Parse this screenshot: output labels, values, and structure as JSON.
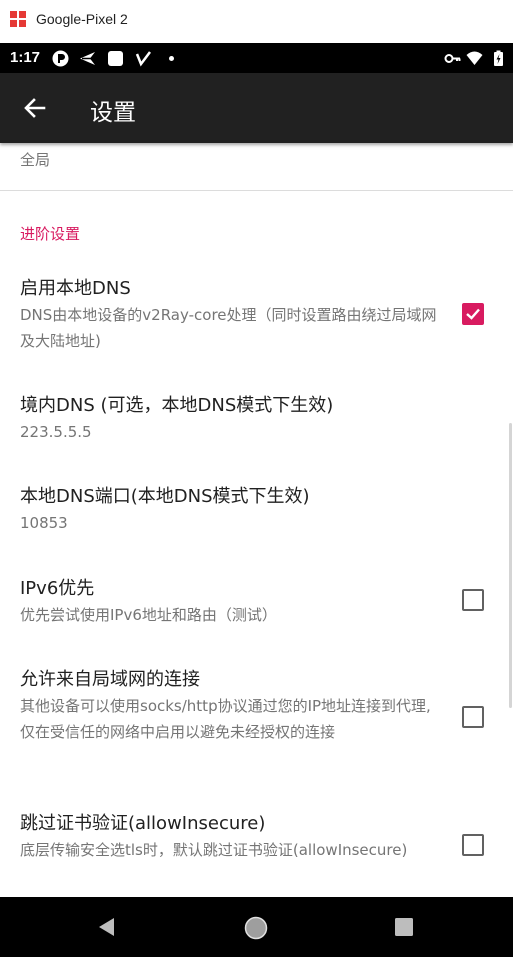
{
  "window": {
    "title": "Google-Pixel 2",
    "logo_color": "#e53935"
  },
  "status_bar": {
    "time": "1:17",
    "left_icons": [
      "app-icon",
      "send-icon",
      "square-icon",
      "v2ray-icon",
      "dot-icon"
    ],
    "right_icons": [
      "vpn-key-icon",
      "wifi-icon",
      "battery-icon"
    ]
  },
  "toolbar": {
    "title": "设置",
    "background": "#212121"
  },
  "settings": {
    "top_summary": "全局",
    "category": "进阶设置",
    "accent_color": "#d81b60",
    "items": [
      {
        "title": "启用本地DNS",
        "summary": "DNS由本地设备的v2Ray-core处理（同时设置路由绕过局域网及大陆地址)",
        "has_checkbox": true,
        "checked": true
      },
      {
        "title": "境内DNS (可选，本地DNS模式下生效)",
        "summary": "223.5.5.5",
        "has_checkbox": false
      },
      {
        "title": "本地DNS端口(本地DNS模式下生效)",
        "summary": "10853",
        "has_checkbox": false
      },
      {
        "title": "IPv6优先",
        "summary": "优先尝试使用IPv6地址和路由（测试）",
        "has_checkbox": true,
        "checked": false
      },
      {
        "title": "允许来自局域网的连接",
        "summary": "其他设备可以使用socks/http协议通过您的IP地址连接到代理,仅在受信任的网络中启用以避免未经授权的连接",
        "has_checkbox": true,
        "checked": false
      },
      {
        "title": "跳过证书验证(allowInsecure)",
        "summary": "底层传输安全选tls时，默认跳过证书验证(allowInsecure)",
        "has_checkbox": true,
        "checked": false
      }
    ]
  },
  "nav_bar": {
    "buttons": [
      "back-triangle-icon",
      "home-circle-icon",
      "recents-square-icon"
    ]
  }
}
